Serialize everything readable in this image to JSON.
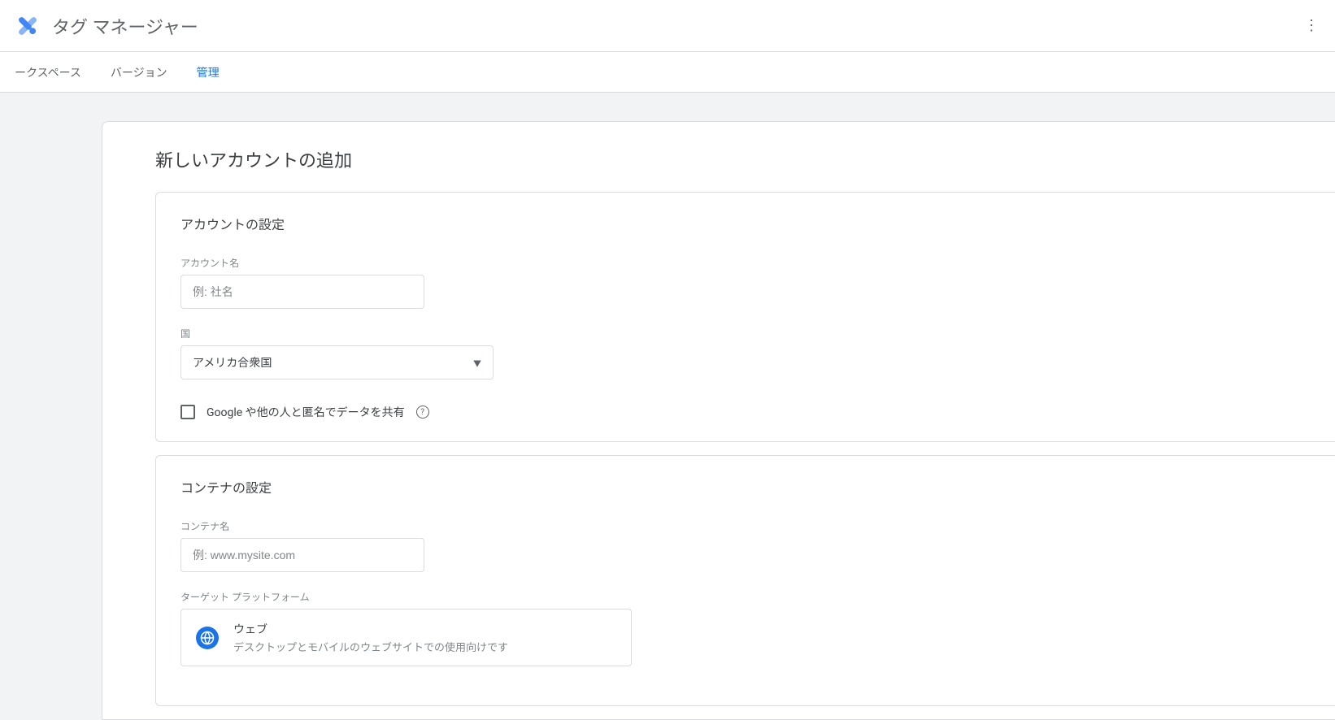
{
  "header": {
    "app_title": "タグ マネージャー"
  },
  "tabs": {
    "workspace": "ークスペース",
    "version": "バージョン",
    "admin": "管理"
  },
  "page": {
    "title": "新しいアカウントの追加"
  },
  "account_section": {
    "title": "アカウントの設定",
    "name_label": "アカウント名",
    "name_placeholder": "例: 社名",
    "country_label": "国",
    "country_value": "アメリカ合衆国",
    "share_checkbox_label": "Google や他の人と匿名でデータを共有"
  },
  "container_section": {
    "title": "コンテナの設定",
    "name_label": "コンテナ名",
    "name_placeholder": "例: www.mysite.com",
    "platform_label": "ターゲット プラットフォーム",
    "platforms": [
      {
        "title": "ウェブ",
        "desc": "デスクトップとモバイルのウェブサイトでの使用向けです"
      }
    ]
  }
}
